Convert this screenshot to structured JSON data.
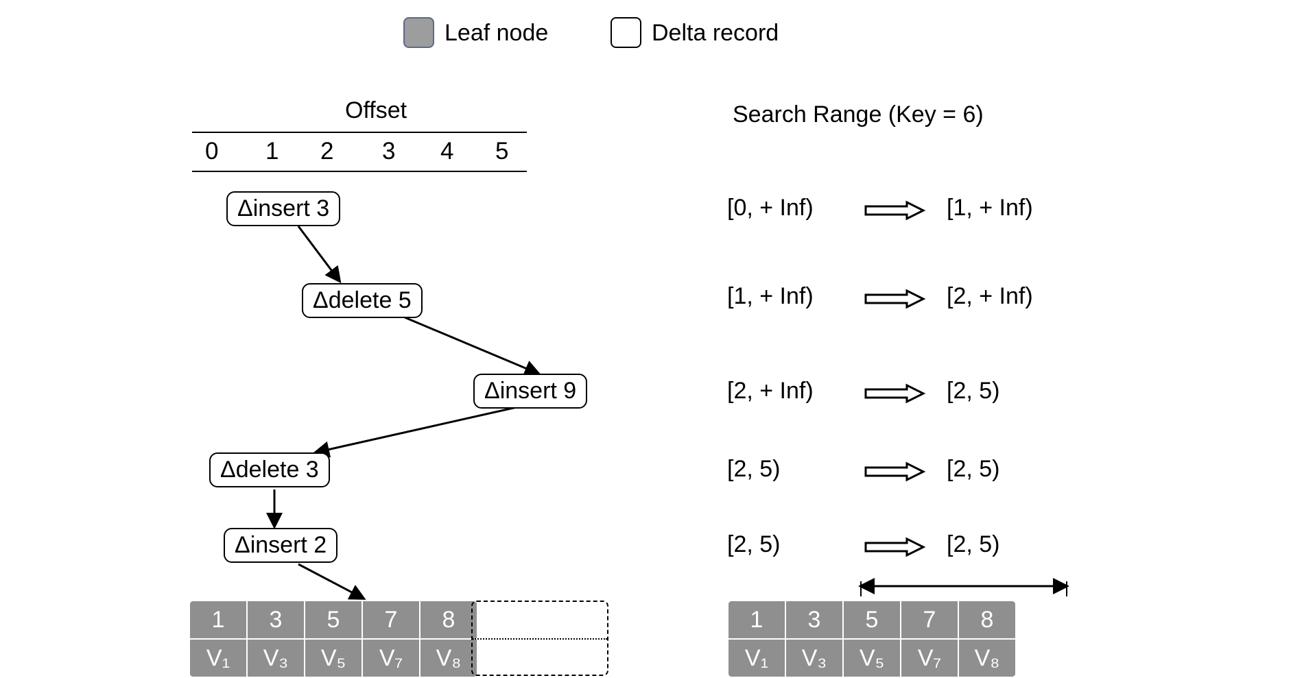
{
  "legend": {
    "leaf_label": "Leaf node",
    "delta_label": "Delta record"
  },
  "offset": {
    "title": "Offset",
    "ticks": [
      "0",
      "1",
      "2",
      "3",
      "4",
      "5"
    ]
  },
  "deltas": {
    "d0": "Δinsert 3",
    "d1": "Δdelete 5",
    "d2": "Δinsert 9",
    "d3": "Δdelete 3",
    "d4": "Δinsert 2"
  },
  "leaf": {
    "keys": [
      "1",
      "3",
      "5",
      "7",
      "8"
    ],
    "values": [
      "V₁",
      "V₃",
      "V₅",
      "V₇",
      "V₈"
    ]
  },
  "search": {
    "title": "Search Range (Key = 6)",
    "rows": [
      {
        "from": "[0, + Inf)",
        "to": "[1, + Inf)"
      },
      {
        "from": "[1, + Inf)",
        "to": "[2, + Inf)"
      },
      {
        "from": "[2, + Inf)",
        "to": "[2, 5)"
      },
      {
        "from": "[2, 5)",
        "to": "[2, 5)"
      },
      {
        "from": "[2, 5)",
        "to": "[2, 5)"
      }
    ]
  }
}
